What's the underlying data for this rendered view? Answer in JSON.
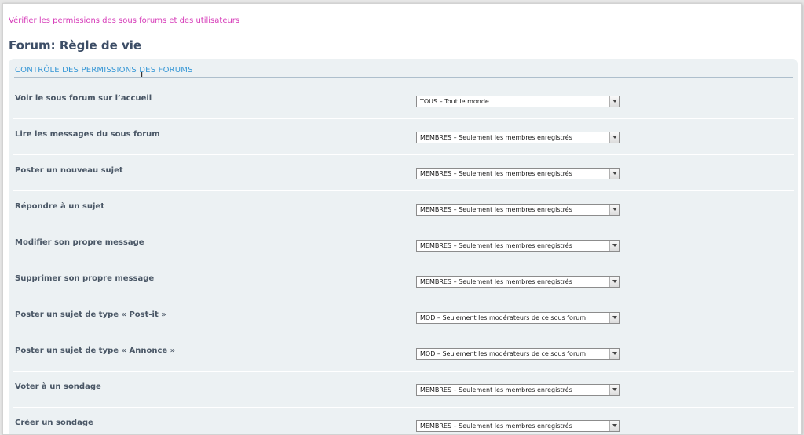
{
  "top_link": "Vérifier les permissions des sous forums et des utilisateurs",
  "forum_title": "Forum: Règle de vie",
  "section_title": "CONTRÔLE DES PERMISSIONS DES FORUMS",
  "permissions": [
    {
      "label": "Voir le sous forum sur l’accueil",
      "value": "TOUS – Tout le monde"
    },
    {
      "label": "Lire les messages du sous forum",
      "value": "MEMBRES – Seulement les membres enregistrés"
    },
    {
      "label": "Poster un nouveau sujet",
      "value": "MEMBRES – Seulement les membres enregistrés"
    },
    {
      "label": "Répondre à un sujet",
      "value": "MEMBRES – Seulement les membres enregistrés"
    },
    {
      "label": "Modifier son propre message",
      "value": "MEMBRES – Seulement les membres enregistrés"
    },
    {
      "label": "Supprimer son propre message",
      "value": "MEMBRES – Seulement les membres enregistrés"
    },
    {
      "label": "Poster un sujet de type « Post-it »",
      "value": "MOD – Seulement les modérateurs de ce sous forum"
    },
    {
      "label": "Poster un sujet de type « Annonce »",
      "value": "MOD – Seulement les modérateurs de ce sous forum"
    },
    {
      "label": "Voter à un sondage",
      "value": "MEMBRES – Seulement les membres enregistrés"
    },
    {
      "label": "Créer un sondage",
      "value": "MEMBRES – Seulement les membres enregistrés"
    }
  ],
  "icons": {
    "select_arrow": "chevron-down-icon",
    "text_cursor": "text-cursor-icon"
  },
  "colors": {
    "link": "#d63ab8",
    "title": "#3c4d66",
    "section_title": "#3697d6",
    "panel_bg": "#ecf1f3",
    "label": "#4a5766"
  }
}
